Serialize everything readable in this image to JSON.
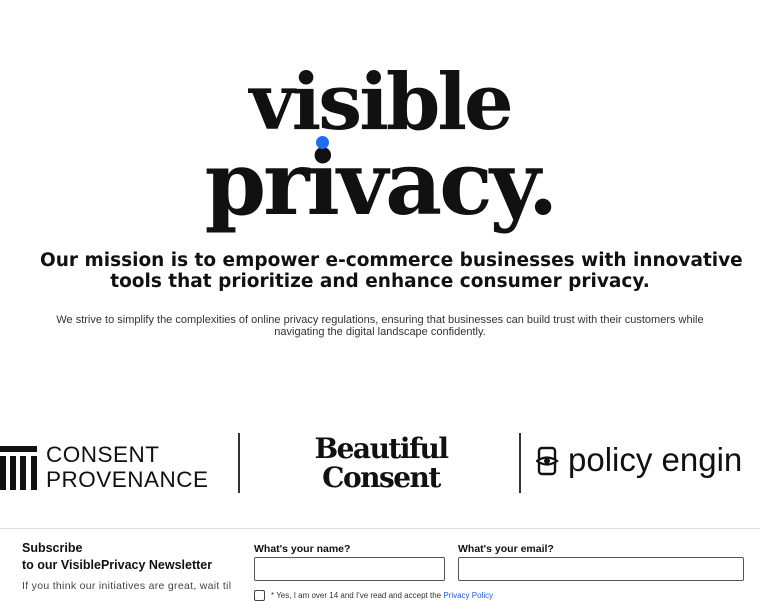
{
  "logo": {
    "line1": "visible",
    "line2": "privacy.",
    "accent_color": "#1f6ef0"
  },
  "mission": {
    "headline_line1": "Our mission is to empower e-commerce businesses with innovative",
    "headline_line2": "tools that prioritize and enhance consumer privacy.",
    "body_line1": "We strive to simplify the complexities of online privacy regulations, ensuring that businesses can build trust with their customers while",
    "body_line2": "navigating the digital landscape confidently."
  },
  "partners": {
    "consent_provenance": {
      "line1": "CONSENT",
      "line2": "PROVENANCE"
    },
    "beautiful_consent": {
      "line1": "Beautiful",
      "line2": "Consent"
    },
    "policy_engine": {
      "text": "policy engin"
    }
  },
  "newsletter": {
    "title_line1": "Subscribe",
    "title_line2": "to our VisiblePrivacy Newsletter",
    "body": "If you think our initiatives are great, wait til you see our emails. Get your monthly dose",
    "name_label": "What's your name?",
    "name_value": "",
    "email_label": "What's your email?",
    "email_value": "",
    "consent_text": "* Yes, I am over 14 and I've read and accept the",
    "privacy_link": "Privacy Policy"
  }
}
